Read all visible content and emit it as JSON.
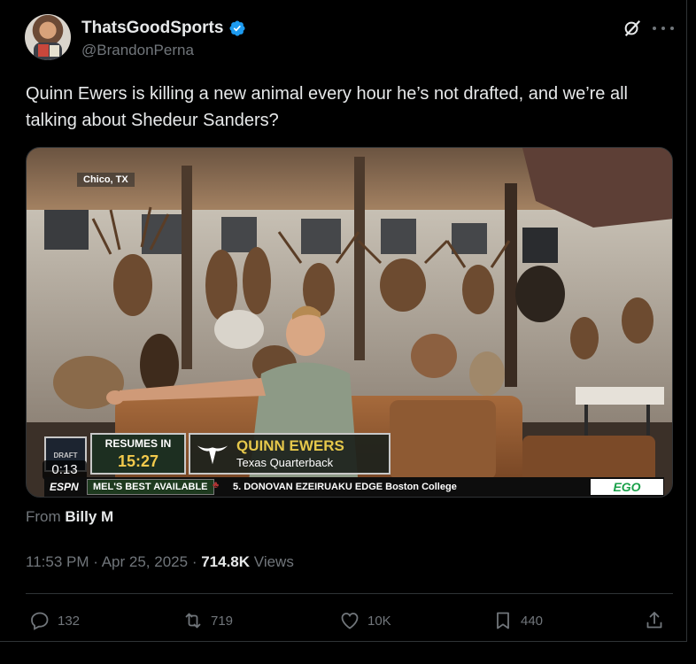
{
  "author": {
    "display_name": "ThatsGoodSports",
    "handle": "@BrandonPerna",
    "verified": true
  },
  "header_icons": [
    "grok-icon",
    "more-icon"
  ],
  "tweet": {
    "text": "Quinn Ewers is killing a new animal every hour he’s not drafted, and we’re all talking about Shedeur Sanders?"
  },
  "media": {
    "location_tag": "Chico, TX",
    "video_time": "0:13",
    "broadcast": {
      "logo_text": "DRAFT",
      "resumes_label": "RESUMES IN",
      "resumes_time": "15:27",
      "player_name": "QUINN EWERS",
      "player_subtitle": "Texas Quarterback",
      "network": "ESPN",
      "ticker_label": "MEL'S BEST AVAILABLE",
      "ticker_pick": "5. DONOVAN EZEIRUAKU  EDGE  Boston College",
      "sponsor": "EGO"
    }
  },
  "attribution": {
    "prefix": "From",
    "source": "Billy M"
  },
  "meta": {
    "time": "11:53 PM",
    "separator": "·",
    "date": "Apr 25, 2025",
    "views_count": "714.8K",
    "views_label": "Views"
  },
  "actions": {
    "replies": "132",
    "reposts": "719",
    "likes": "10K",
    "bookmarks": "440"
  },
  "colors": {
    "background": "#000000",
    "text_primary": "#e7e9ea",
    "text_secondary": "#71767b",
    "verified_blue": "#1d9bf0",
    "border": "#2f3336"
  }
}
